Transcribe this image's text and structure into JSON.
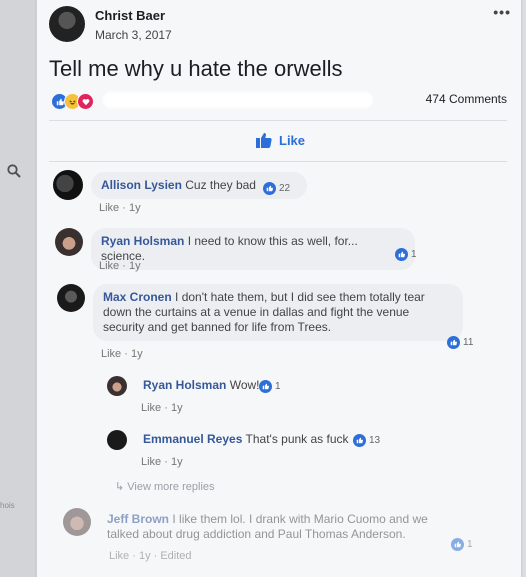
{
  "left": {
    "cut_text": "hois"
  },
  "post": {
    "author": "Christ Baer",
    "date": "March 3, 2017",
    "more_icon": "•••",
    "text": "Tell me why u hate the orwells",
    "comments_count": "474 Comments",
    "like_label": "Like"
  },
  "comments": [
    {
      "name": "Allison Lysien",
      "text": "Cuz they bad",
      "likes": "22",
      "meta": "Like · 1y"
    },
    {
      "name": "Ryan Holsman",
      "text": "I need to know this as well, for... science.",
      "likes": "1",
      "meta": "Like · 1y"
    },
    {
      "name": "Max Cronen",
      "text": "I don't hate them, but I did see them totally tear down the curtains at a venue in dallas and fight the venue security and get banned for life from Trees.",
      "likes": "11",
      "meta": "Like · 1y"
    },
    {
      "name": "Ryan Holsman",
      "text": "Wow!",
      "likes": "1",
      "meta": "Like · 1y"
    },
    {
      "name": "Emmanuel Reyes",
      "text": "That's punk as fuck",
      "likes": "13",
      "meta": "Like · 1y"
    },
    {
      "name": "Jeff Brown",
      "text": "I like them lol. I drank with Mario Cuomo and we talked about drug addiction and Paul Thomas Anderson.",
      "likes": "1",
      "meta": "Like · 1y · Edited"
    }
  ],
  "view_more_replies": "View more replies",
  "colors": {
    "accent": "#2d6fd8",
    "name": "#365899"
  }
}
